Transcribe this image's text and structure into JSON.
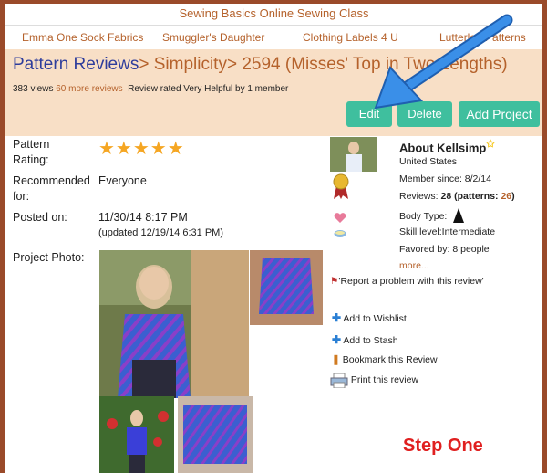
{
  "ad": {
    "title": "Sewing Basics Online Sewing Class",
    "links": [
      "Emma One Sock Fabrics",
      "Smuggler's Daughter",
      "Clothing Labels 4 U",
      "Lutterloh Patterns"
    ]
  },
  "breadcrumb": {
    "part1": "Pattern Reviews",
    "sep": ">",
    "part2": "Simplicity",
    "part3": "2594 (Misses' Top in Two Lengths)"
  },
  "stats": {
    "views": "383 views",
    "more": "60 more reviews",
    "rated": "Review rated Very Helpful by 1 member"
  },
  "buttons": {
    "edit": "Edit",
    "delete": "Delete",
    "add_project": "Add Project"
  },
  "review": {
    "rating_label_1": "Pattern",
    "rating_label_2": "Rating:",
    "stars": "★★★★★",
    "recommended_label_1": "Recommended",
    "recommended_label_2": "for:",
    "recommended_value": "Everyone",
    "posted_label": "Posted on:",
    "posted_value": "11/30/14 8:17 PM",
    "updated_value": "(updated 12/19/14 6:31 PM)",
    "photo_label": "Project Photo:"
  },
  "member": {
    "about": "About Kellsimp",
    "country": "United States",
    "since": "Member since: 8/2/14",
    "reviews_prefix": "Reviews: ",
    "reviews_count": "28",
    "patterns_prefix": " (patterns: ",
    "patterns_count": "26",
    "patterns_suffix": ")",
    "body_type": "Body Type:",
    "skill": "Skill level:Intermediate",
    "favored": "Favored by: 8 people",
    "more": "more..."
  },
  "actions": {
    "report": "Report a problem with this review",
    "wishlist": "Add to Wishlist",
    "stash": "Add to Stash",
    "bookmark": "Bookmark this Review",
    "print": "Print this review"
  },
  "annotation": {
    "step": "Step One"
  },
  "colors": {
    "accent": "#b5622c",
    "teal": "#3fbf9e",
    "header_bg": "#f8dfc6",
    "link_blue": "#2e3d9c",
    "arrow": "#2e7fd8"
  }
}
